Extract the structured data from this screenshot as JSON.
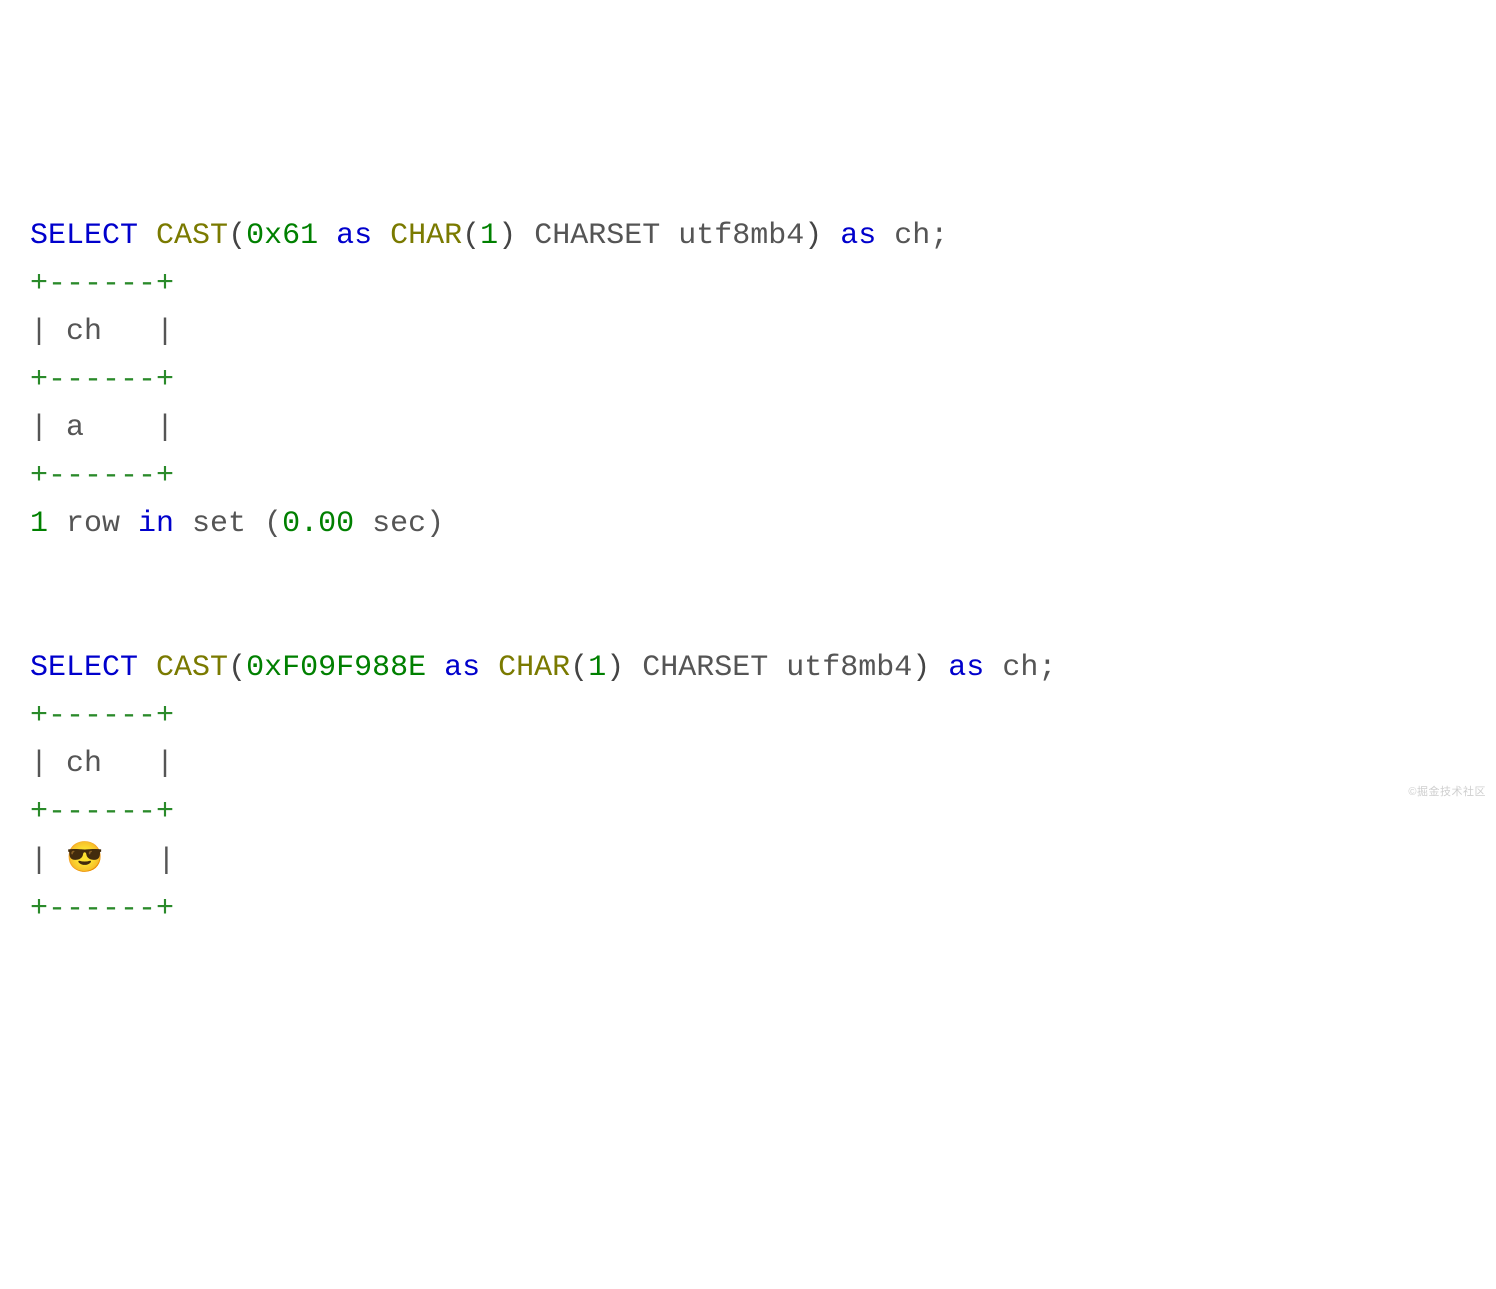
{
  "query1": {
    "select": "SELECT",
    "cast": "CAST",
    "lp1": "(",
    "hex": "0x61",
    "as1": "as",
    "char": "CHAR",
    "lp2": "(",
    "charlen": "1",
    "rp2": ")",
    "charset": " CHARSET utf8mb4",
    "rp1": ")",
    "as2": "as",
    "alias": " ch;"
  },
  "result1": {
    "border_top": "+------+",
    "header": "| ch   |",
    "border_mid": "+------+",
    "row": "| a    |",
    "border_bot": "+------+",
    "status_pre": "1",
    "status_mid1": " row ",
    "status_mid2": "in",
    "status_mid3": " set (",
    "status_time": "0.00",
    "status_post": " sec)"
  },
  "query2": {
    "select": "SELECT",
    "cast": "CAST",
    "lp1": "(",
    "hex": "0xF09F988E",
    "as1": "as",
    "char": "CHAR",
    "lp2": "(",
    "charlen": "1",
    "rp2": ")",
    "charset": " CHARSET utf8mb4",
    "rp1": ")",
    "as2": "as",
    "alias": " ch;"
  },
  "result2": {
    "border_top": "+------+",
    "header": "| ch   |",
    "border_mid": "+------+",
    "row_pre": "| ",
    "row_emoji": "😎",
    "row_post": "   |",
    "border_bot": "+------+"
  },
  "watermark": "©掘金技术社区"
}
